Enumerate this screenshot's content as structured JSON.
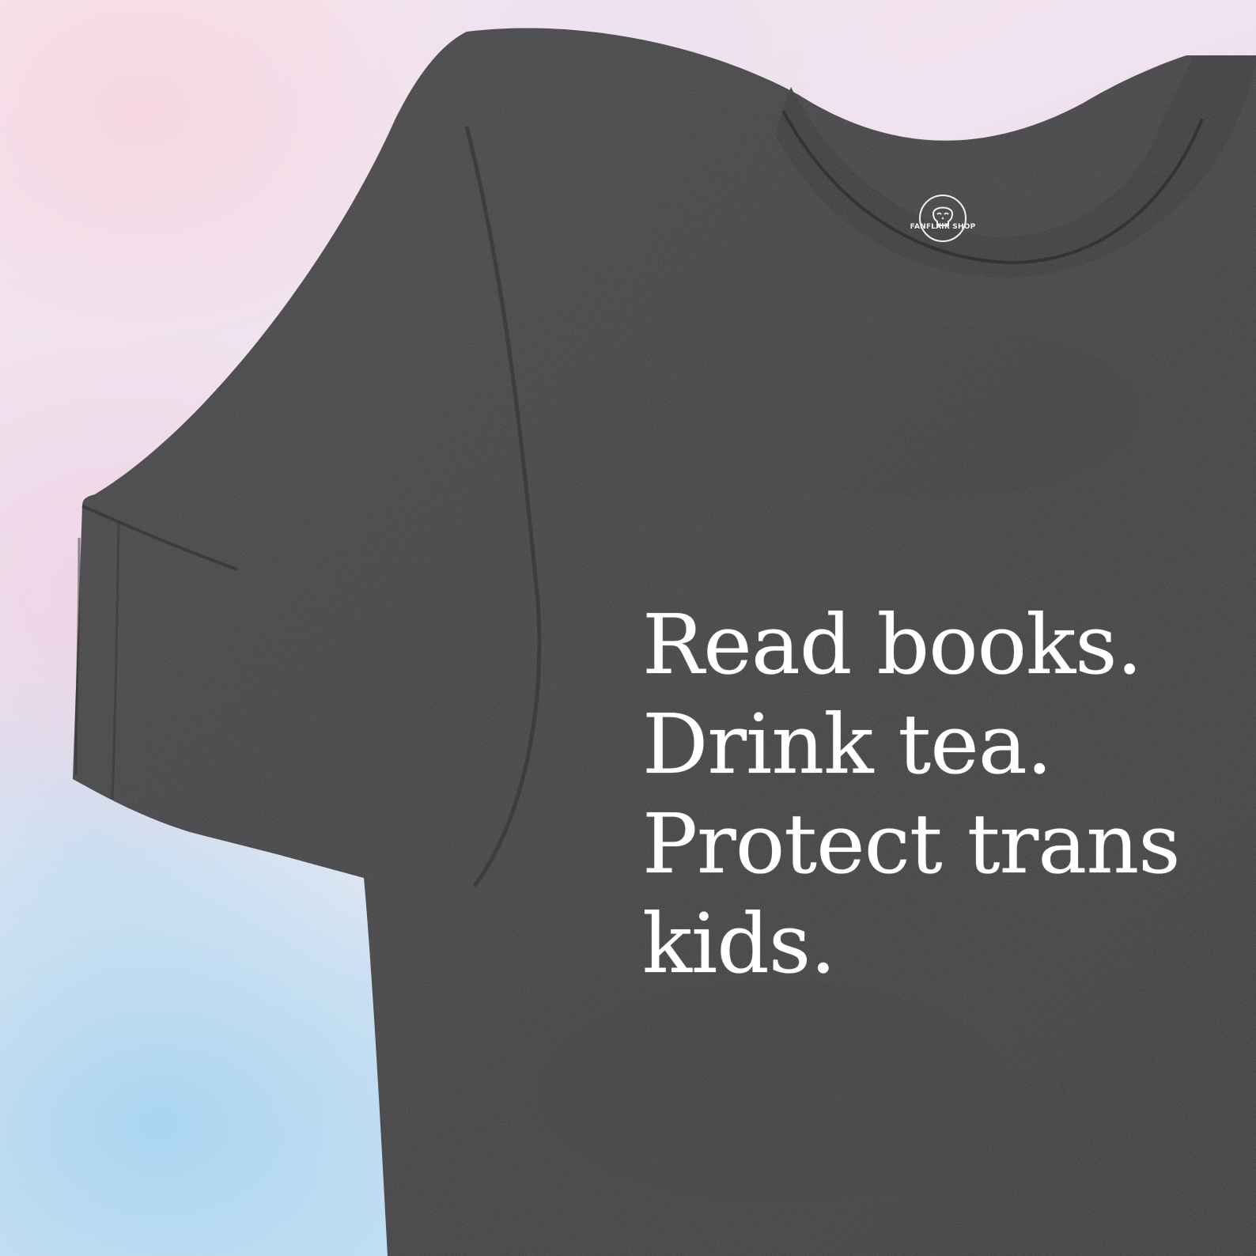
{
  "scene": {
    "background_colors": [
      "#f6e4ec",
      "#e2e6f2",
      "#b6daf2"
    ],
    "shirt_color": "#3b3b3d",
    "text_color": "#ffffff"
  },
  "label": {
    "brand": "FANFLAIR SHOP",
    "logo_icon": "skull-icon"
  },
  "slogan": {
    "line1": "Read books.",
    "line2": "Drink tea.",
    "line3": "Protect trans",
    "line4": "kids."
  }
}
